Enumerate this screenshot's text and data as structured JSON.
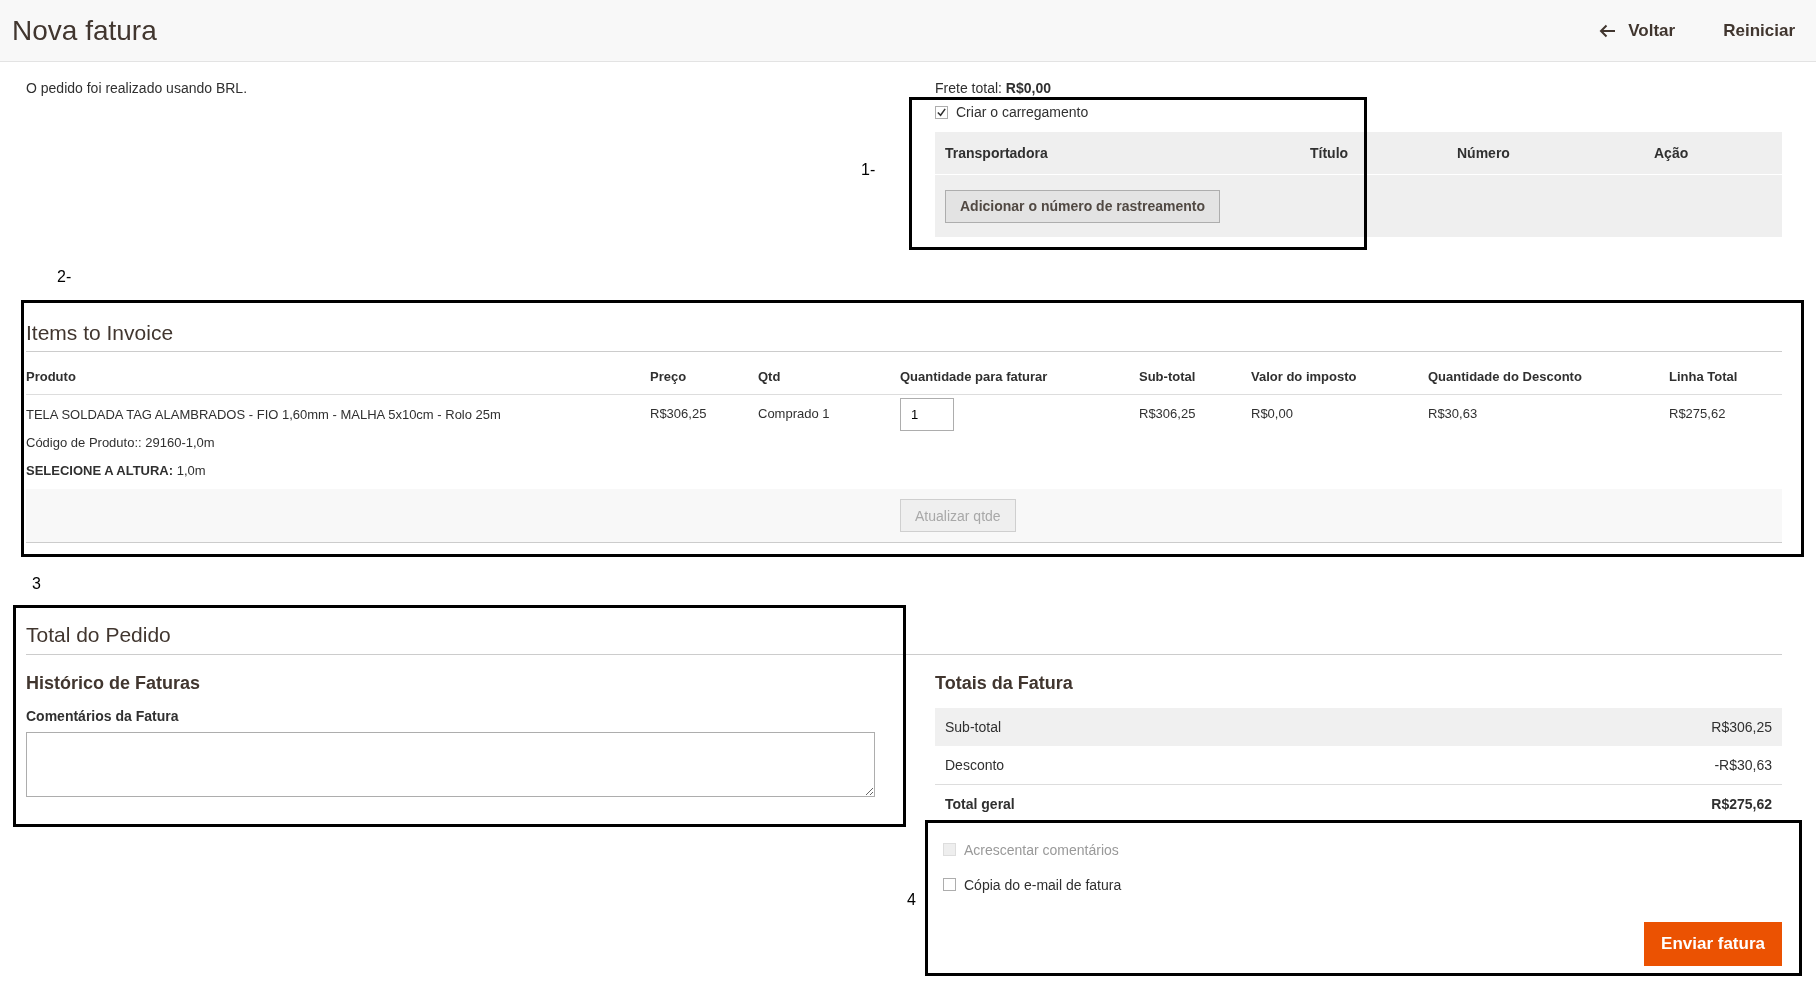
{
  "header": {
    "title": "Nova fatura",
    "actions": [
      {
        "label": "Voltar",
        "kind": "back"
      },
      {
        "label": "Reiniciar",
        "kind": "plain"
      }
    ]
  },
  "order_info": {
    "currency_note": "O pedido foi realizado usando BRL."
  },
  "shipping": {
    "total": "Frete total: **R$0,00**",
    "create_shipment": {
      "label": "Criar o carregamento",
      "checked": true
    },
    "tracking": {
      "columns": [
        "Transportadora",
        "Título",
        "Número",
        "Ação"
      ],
      "add_button": "Adicionar o número de rastreamento"
    }
  },
  "items": {
    "title": "Items to Invoice",
    "columns": [
      "Produto",
      "Preço",
      "Qtd",
      "Quantidade para faturar",
      "Sub-total",
      "Valor do imposto",
      "Quantidade do Desconto",
      "Linha Total"
    ],
    "rows": [
      {
        "product": "TELA SOLDADA TAG ALAMBRADOS - FIO 1,60mm - MALHA 5x10cm - Rolo 25m",
        "sku": "Código de Produto:: 29160-1,0m",
        "option": "**SELECIONE A ALTURA:** 1,0m",
        "price": "R$306,25",
        "qty": "Comprado 1",
        "qty_to_invoice": "1",
        "subtotal": "R$306,25",
        "tax": "R$0,00",
        "discount": "R$30,63",
        "row_total": "R$275,62"
      }
    ],
    "update_button": {
      "label": "Atualizar qtde",
      "disabled": true
    }
  },
  "order_total": {
    "title": "Total do Pedido",
    "history": {
      "title": "Histórico de Faturas",
      "comment_label": "Comentários da Fatura"
    },
    "totals": {
      "title": "Totais da Fatura",
      "rows": [
        {
          "label": "Sub-total",
          "value": "R$306,25",
          "kind": "shaded"
        },
        {
          "label": "Desconto",
          "value": "-R$30,63",
          "kind": "plain"
        },
        {
          "label": "Total geral",
          "value": "R$275,62",
          "kind": "grand"
        }
      ]
    },
    "options": [
      {
        "label": "Acrescentar comentários",
        "checked": false,
        "disabled": true
      },
      {
        "label": "Cópia do e-mail de fatura",
        "checked": false,
        "disabled": false
      }
    ],
    "submit_button": "Enviar fatura"
  },
  "annotations": [
    {
      "label": "1-"
    },
    {
      "label": "2-"
    },
    {
      "label": "3"
    },
    {
      "label": "4"
    }
  ]
}
